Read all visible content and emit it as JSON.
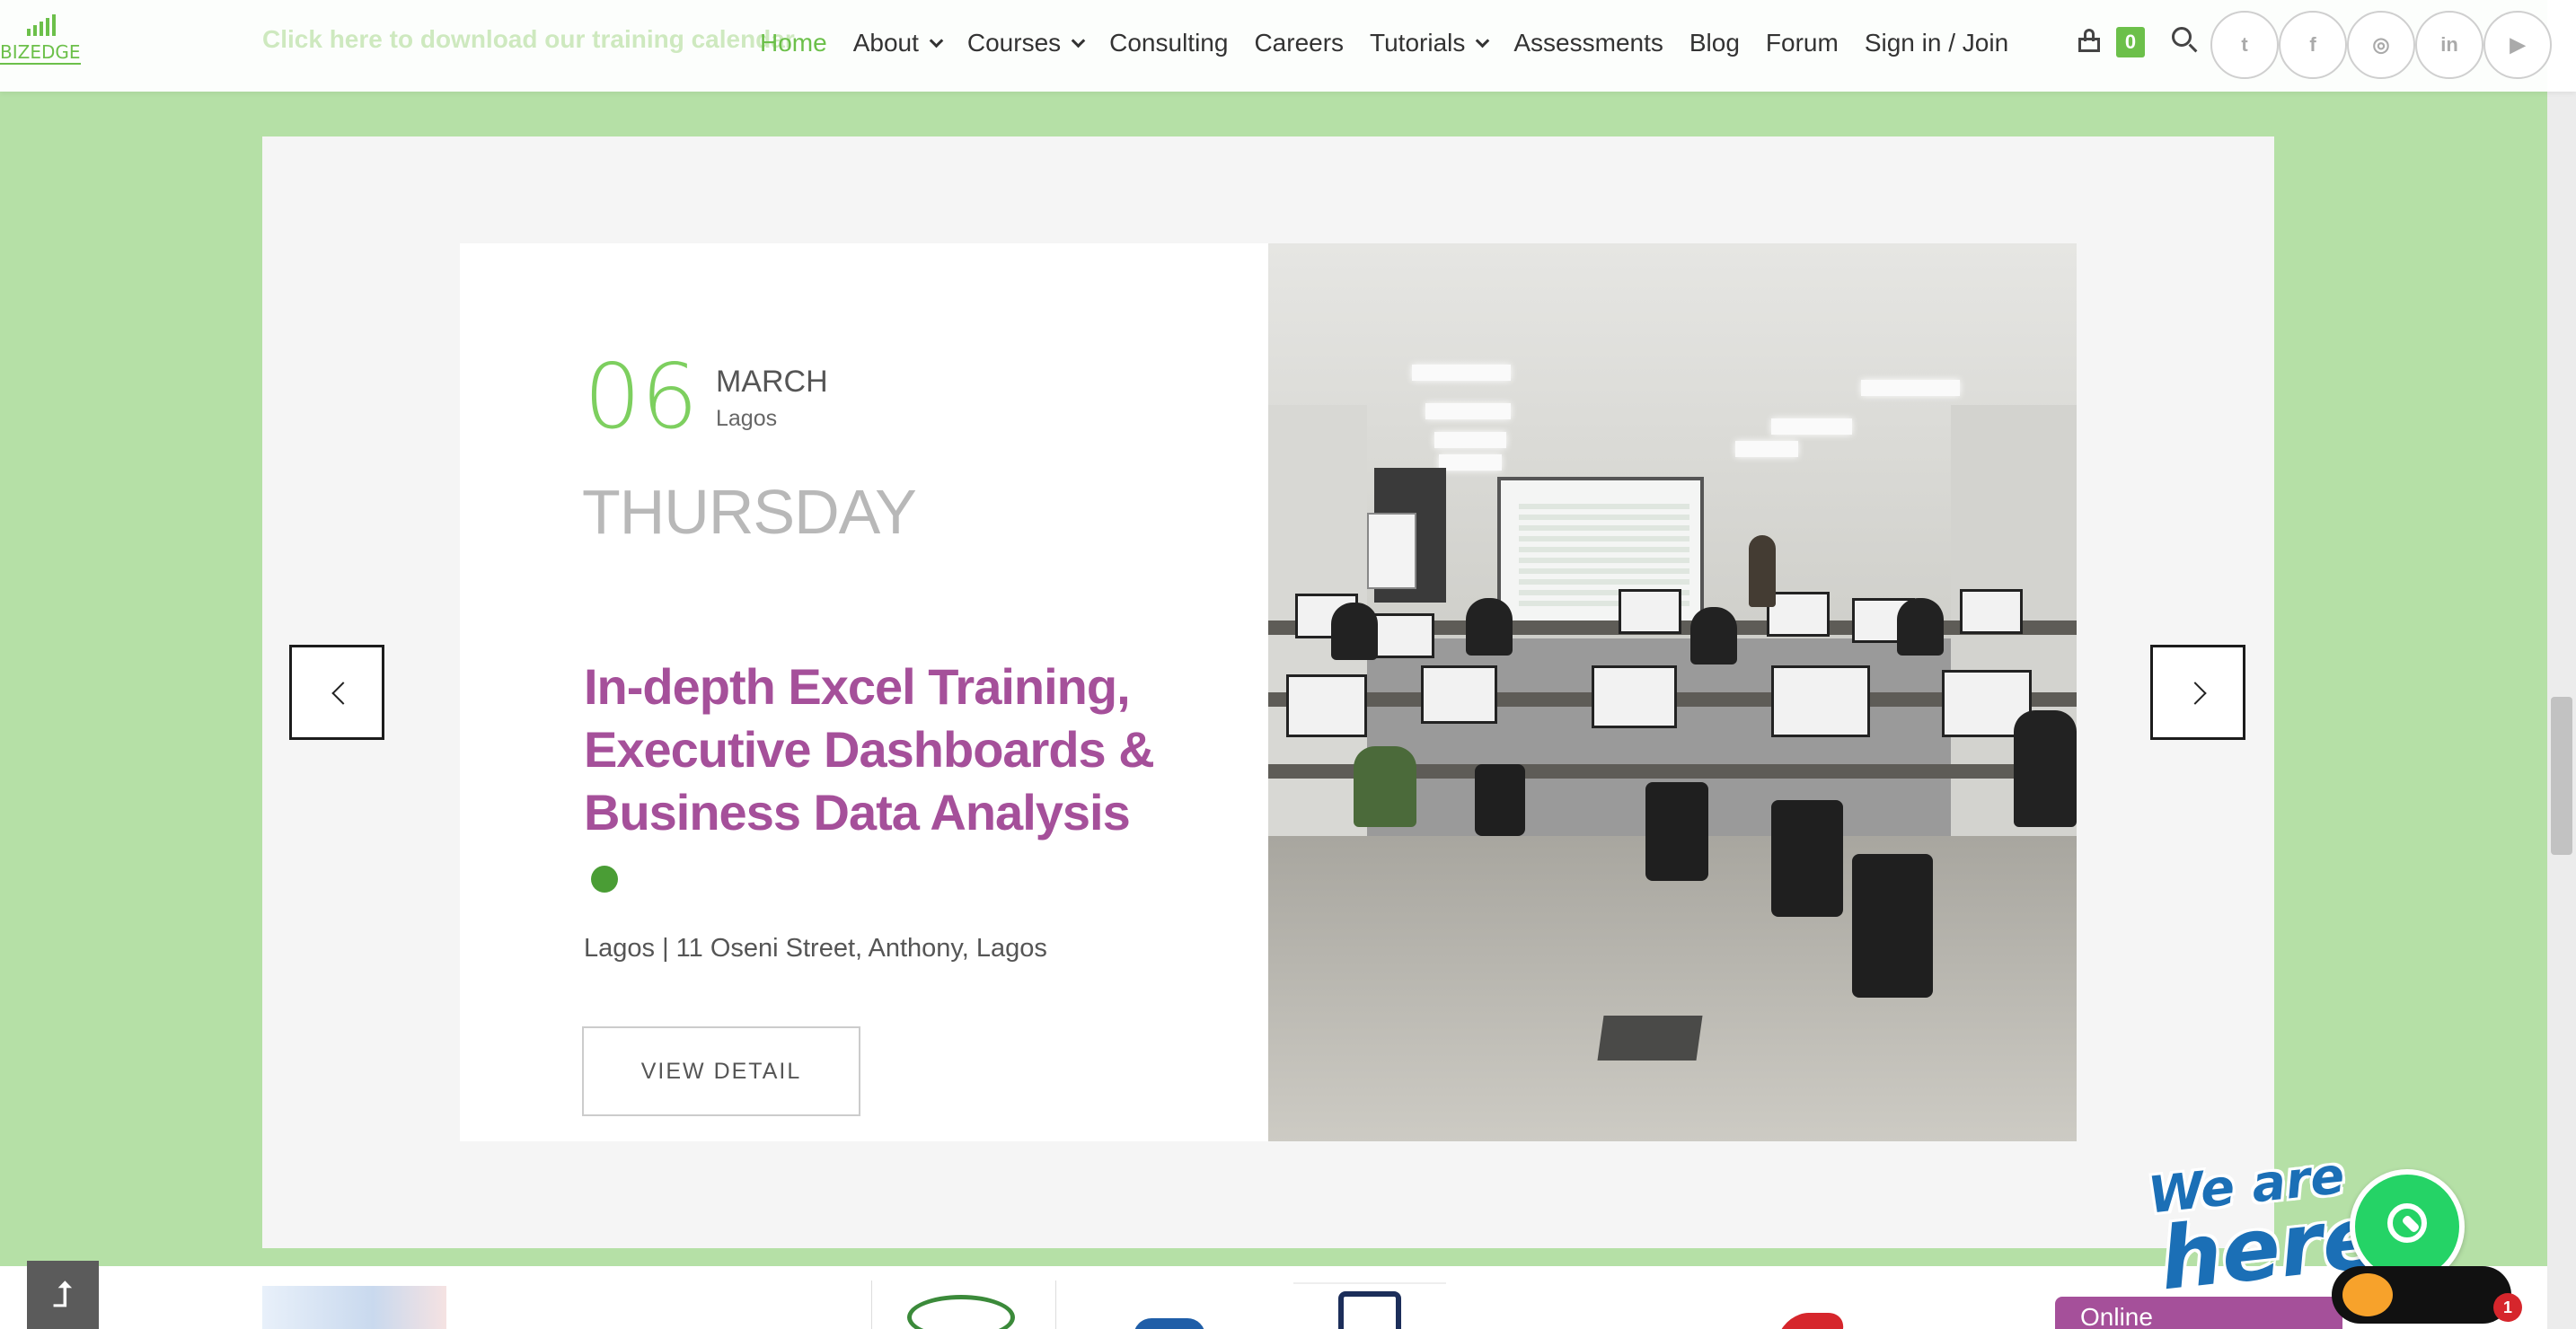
{
  "header": {
    "brand": "BIZEDGE",
    "ghost_text": "Click here to download our training calendar",
    "nav": [
      {
        "label": "Home",
        "has_dropdown": false,
        "active": true
      },
      {
        "label": "About",
        "has_dropdown": true,
        "active": false
      },
      {
        "label": "Courses",
        "has_dropdown": true,
        "active": false
      },
      {
        "label": "Consulting",
        "has_dropdown": false,
        "active": false
      },
      {
        "label": "Careers",
        "has_dropdown": false,
        "active": false
      },
      {
        "label": "Tutorials",
        "has_dropdown": true,
        "active": false
      },
      {
        "label": "Assessments",
        "has_dropdown": false,
        "active": false
      },
      {
        "label": "Blog",
        "has_dropdown": false,
        "active": false
      },
      {
        "label": "Forum",
        "has_dropdown": false,
        "active": false
      },
      {
        "label": "Sign in / Join",
        "has_dropdown": false,
        "active": false
      }
    ],
    "cart_count": "0",
    "social": [
      {
        "name": "twitter-icon",
        "glyph": "t"
      },
      {
        "name": "facebook-icon",
        "glyph": "f"
      },
      {
        "name": "instagram-icon",
        "glyph": "◎"
      },
      {
        "name": "linkedin-icon",
        "glyph": "in"
      },
      {
        "name": "youtube-icon",
        "glyph": "▶"
      }
    ]
  },
  "event": {
    "day": "06",
    "month": "MARCH",
    "city": "Lagos",
    "weekday": "THURSDAY",
    "title": "In-depth Excel Training, Executive Dashboards & Business Data Analysis",
    "address": "Lagos | 11 Oseni Street, Anthony, Lagos",
    "button_label": "VIEW DETAIL",
    "photo": "training-room-photo"
  },
  "carousel": {
    "prev_icon": "chevron-left-icon",
    "next_icon": "chevron-right-icon"
  },
  "widget": {
    "we_are": "We are",
    "here": "here!",
    "online_label": "Online",
    "notification_count": "1"
  },
  "back_to_top": "⮥",
  "colors": {
    "accent_green": "#6cc04a",
    "title_purple": "#a5509a",
    "page_bg": "#b5e0a6"
  }
}
